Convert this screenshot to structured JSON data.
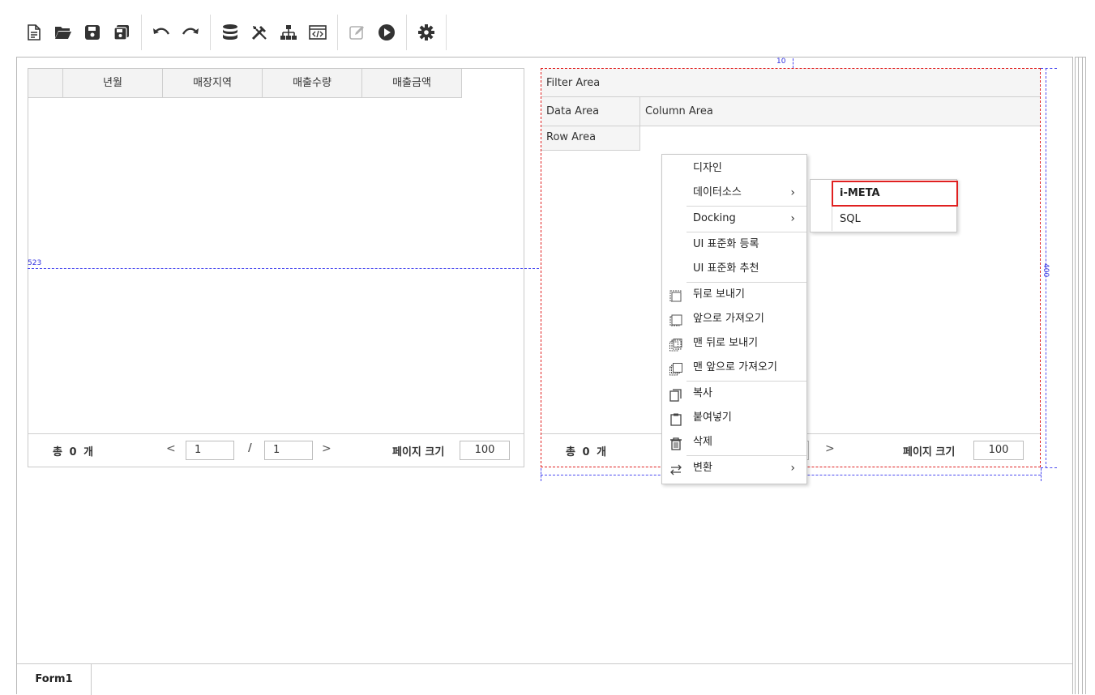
{
  "toolbar": {
    "groups": [
      [
        "new-file-icon",
        "open-folder-icon",
        "save-icon",
        "save-all-icon"
      ],
      [
        "undo-icon",
        "redo-icon"
      ],
      [
        "database-icon",
        "tools-icon",
        "hierarchy-icon",
        "code-view-icon"
      ],
      [
        "edit-icon",
        "run-icon"
      ],
      [
        "settings-icon"
      ]
    ]
  },
  "grid": {
    "columns": [
      "년월",
      "매장지역",
      "매출수량",
      "매출금액"
    ],
    "pager": {
      "total_prefix": "총",
      "total_count": "0",
      "total_suffix": "개",
      "prev": "<",
      "page": "1",
      "slash": "/",
      "pages": "1",
      "next": ">",
      "size_label": "페이지 크기",
      "size": "100"
    }
  },
  "pivot": {
    "filter_area": "Filter Area",
    "data_area": "Data Area",
    "column_area": "Column Area",
    "row_area": "Row Area",
    "pager": {
      "total_prefix": "총",
      "total_count": "0",
      "total_suffix": "개",
      "next": ">",
      "size_label": "페이지 크기",
      "size": "100"
    }
  },
  "guides": {
    "label_523": "523",
    "label_10": "10",
    "label_400": "400"
  },
  "context_menu": {
    "items": [
      {
        "label": "디자인",
        "arrow": ""
      },
      {
        "label": "데이터소스",
        "arrow": "›"
      },
      {
        "label": "Docking",
        "arrow": "›"
      },
      {
        "label": "UI 표준화 등록",
        "arrow": ""
      },
      {
        "label": "UI 표준화 추천",
        "arrow": ""
      },
      {
        "label": "뒤로 보내기",
        "arrow": "",
        "icon": "send-backward-icon"
      },
      {
        "label": "앞으로 가져오기",
        "arrow": "",
        "icon": "bring-forward-icon"
      },
      {
        "label": "맨 뒤로 보내기",
        "arrow": "",
        "icon": "send-to-back-icon"
      },
      {
        "label": "맨 앞으로 가져오기",
        "arrow": "",
        "icon": "bring-to-front-icon"
      },
      {
        "label": "복사",
        "arrow": "",
        "icon": "copy-icon"
      },
      {
        "label": "붙여넣기",
        "arrow": "",
        "icon": "paste-icon"
      },
      {
        "label": "삭제",
        "arrow": "",
        "icon": "delete-icon"
      },
      {
        "label": "변환",
        "arrow": "›",
        "icon": "convert-icon"
      }
    ]
  },
  "submenu": {
    "items": [
      "i-META",
      "SQL"
    ]
  },
  "tabs": [
    "Form1"
  ],
  "colors": {
    "selection_border": "#e02020",
    "guide_line": "#4a4af0",
    "header_bg": "#f3f3f3"
  }
}
